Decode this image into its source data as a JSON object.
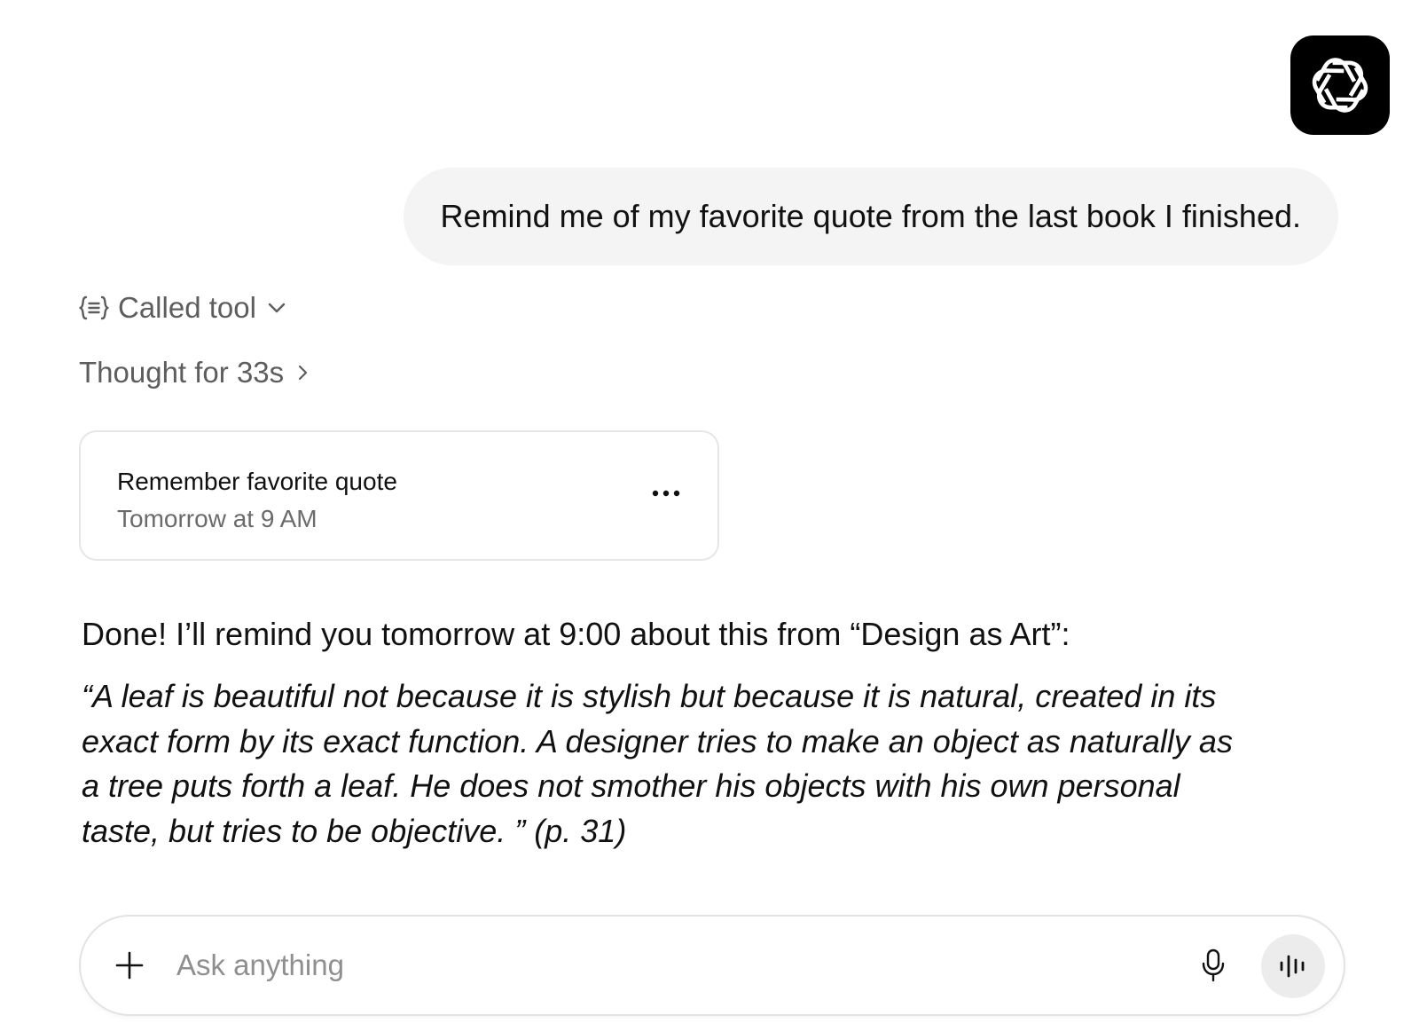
{
  "app": {
    "logo_icon": "openai-logo-icon",
    "logo_background": "#000000"
  },
  "conversation": {
    "user_message": "Remind me of my favorite quote from the last book I finished.",
    "tool_call": {
      "icon": "code-braces-icon",
      "label": "Called tool",
      "state": "collapsed"
    },
    "thought": {
      "label": "Thought for 33s"
    },
    "task_card": {
      "title": "Remember favorite quote",
      "schedule": "Tomorrow at 9 AM",
      "more_icon": "more-horizontal-icon"
    },
    "reply": {
      "intro": "Done! I’ll remind you tomorrow at 9:00 about this from “Design as Art”:",
      "quote": "“A leaf is beautiful not because it is stylish but because it is natural, created in its exact form by its exact function. A designer tries to make an object as naturally as a tree puts forth a leaf. He does not smother his objects with his own personal taste, but tries to be objective. ” (p. 31)"
    }
  },
  "composer": {
    "placeholder": "Ask anything",
    "value": "",
    "add_icon": "plus-icon",
    "mic_icon": "microphone-icon",
    "voice_icon": "voice-mode-icon"
  },
  "colors": {
    "user_bubble": "#f4f4f4",
    "muted_text": "#5d5d5d",
    "border": "#e6e6e6"
  }
}
